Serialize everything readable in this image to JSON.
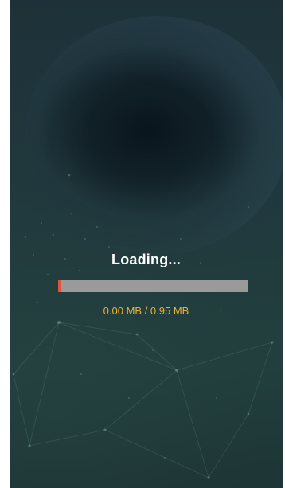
{
  "loader": {
    "title": "Loading...",
    "progress": 0.0,
    "downloaded": "0.00 MB",
    "separator": " / ",
    "total": "0.95 MB"
  },
  "colors": {
    "background": "#213a3d",
    "title": "#ffffff",
    "progress_track": "#9a9a9a",
    "progress_fill": "#e0553a",
    "size_text": "#e8b030"
  }
}
